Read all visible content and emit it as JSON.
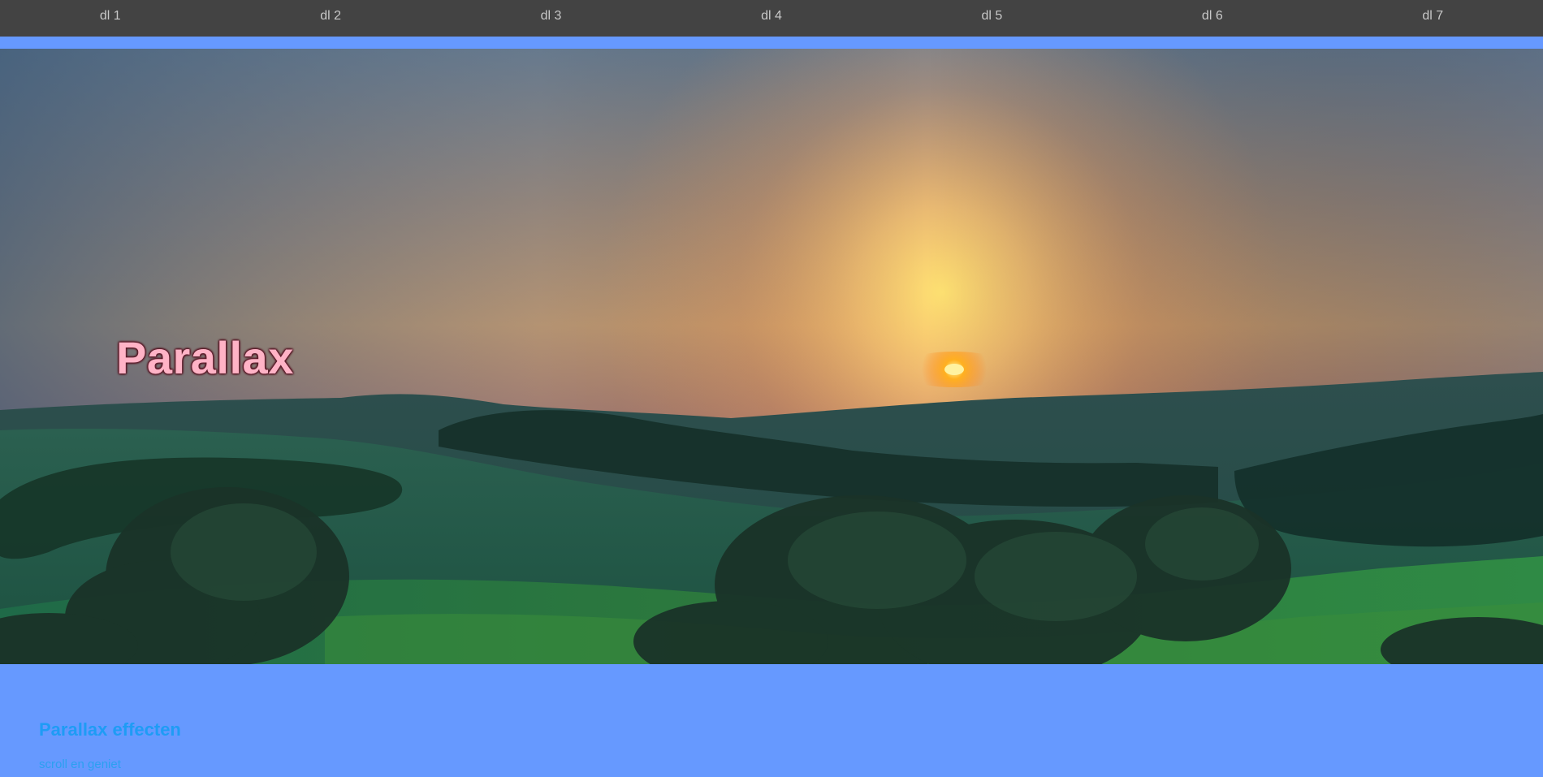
{
  "nav": {
    "items": [
      "dl 1",
      "dl 2",
      "dl 3",
      "dl 4",
      "dl 5",
      "dl 6",
      "dl 7"
    ]
  },
  "hero": {
    "title": "Parallax",
    "image": "sunset-landscape"
  },
  "content": {
    "heading": "Parallax effecten",
    "subtitle": "scroll en geniet"
  },
  "colors": {
    "nav_bg": "#434343",
    "nav_text": "#c8c8c8",
    "page_bg": "#6699ff",
    "heading": "#1e9cf5",
    "hero_title": "#ffb3c6"
  }
}
